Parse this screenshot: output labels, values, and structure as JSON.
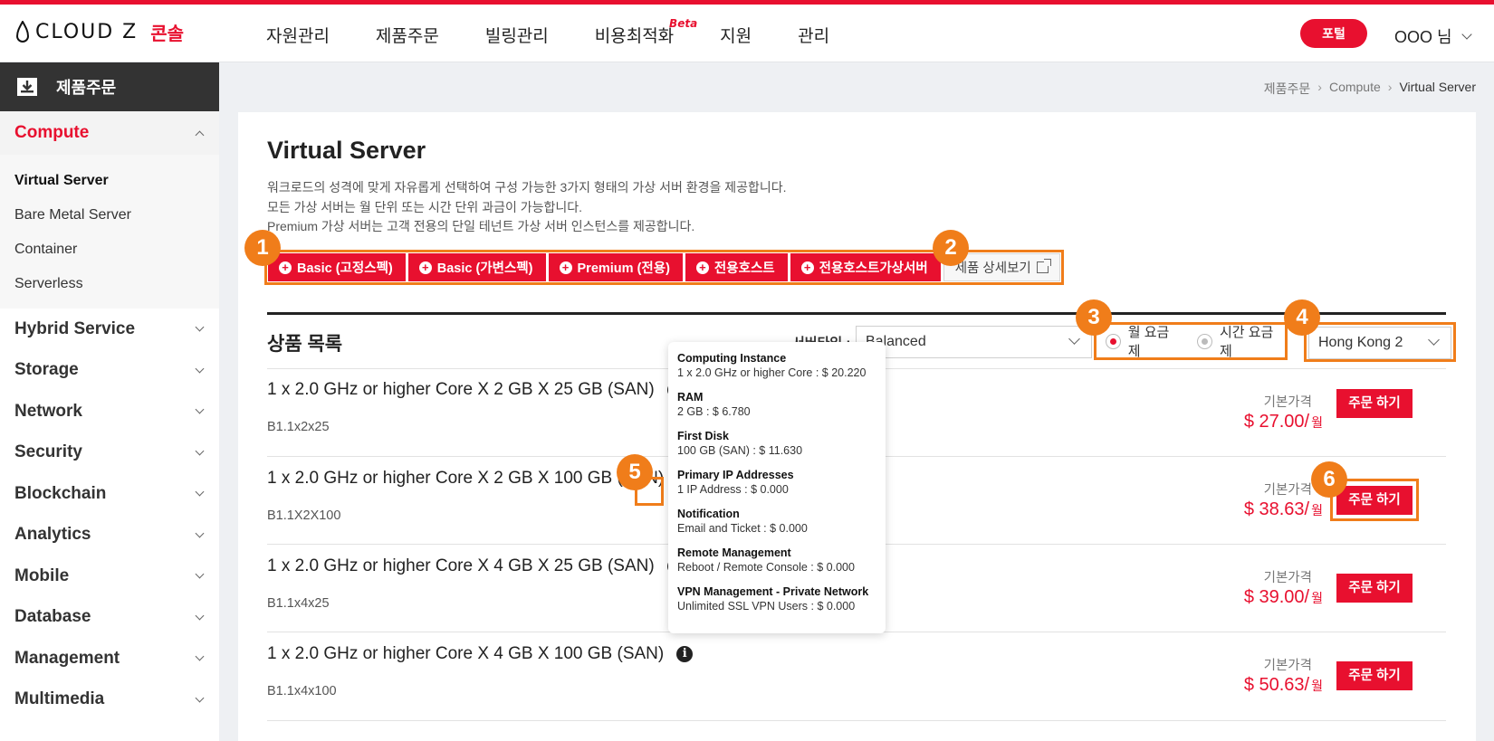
{
  "header": {
    "brand": "CLOUD Z",
    "console": "콘솔",
    "nav": [
      "자원관리",
      "제품주문",
      "빌링관리",
      "비용최적화",
      "지원",
      "관리"
    ],
    "beta": "Beta",
    "portal": "포털",
    "user": "OOO 님"
  },
  "sidebar": {
    "title": "제품주문",
    "active_category": "Compute",
    "sub_items": [
      "Virtual Server",
      "Bare Metal Server",
      "Container",
      "Serverless"
    ],
    "categories": [
      "Hybrid Service",
      "Storage",
      "Network",
      "Security",
      "Blockchain",
      "Analytics",
      "Mobile",
      "Database",
      "Management",
      "Multimedia"
    ]
  },
  "breadcrumb": [
    "제품주문",
    "Compute",
    "Virtual Server"
  ],
  "main": {
    "title": "Virtual Server",
    "desc": [
      "워크로드의 성격에 맞게 자유롭게 선택하여 구성 가능한 3가지 형태의 가상 서버 환경을 제공합니다.",
      "모든 가상 서버는 월 단위 또는 시간 단위 과금이 가능합니다.",
      "Premium 가상 서버는 고객 전용의 단일 테넌트 가상 서버 인스턴스를 제공합니다."
    ],
    "types": [
      "Basic (고정스펙)",
      "Basic (가변스펙)",
      "Premium (전용)",
      "전용호스트",
      "전용호스트가상서버"
    ],
    "detail_button": "제품 상세보기",
    "list_title": "상품 목록",
    "server_type_label": "서버타입 :",
    "server_type_value": "Balanced",
    "billing": [
      "월 요금제",
      "시간 요금제"
    ],
    "region": "Hong Kong 2",
    "base_price_label": "기본가격",
    "order_label": "주문 하기",
    "price_unit": "월",
    "products": [
      {
        "name": "1 x 2.0 GHz or higher Core X 2 GB X 25 GB (SAN)",
        "code": "B1.1x2x25",
        "price": "$ 27.00/"
      },
      {
        "name": "1 x 2.0 GHz or higher Core X 2 GB X 100 GB (SAN)",
        "code": "B1.1X2X100",
        "price": "$ 38.63/"
      },
      {
        "name": "1 x 2.0 GHz or higher Core X 4 GB X 25 GB (SAN)",
        "code": "B1.1x4x25",
        "price": "$ 39.00/"
      },
      {
        "name": "1 x 2.0 GHz or higher Core X 4 GB X 100 GB (SAN)",
        "code": "B1.1x4x100",
        "price": "$ 50.63/"
      }
    ]
  },
  "tooltip": [
    {
      "title": "Computing Instance",
      "value": "1 x 2.0 GHz or higher Core : $ 20.220"
    },
    {
      "title": "RAM",
      "value": "2 GB : $ 6.780"
    },
    {
      "title": "First Disk",
      "value": "100 GB (SAN) : $ 11.630"
    },
    {
      "title": "Primary IP Addresses",
      "value": "1 IP Address : $ 0.000"
    },
    {
      "title": "Notification",
      "value": "Email and Ticket : $ 0.000"
    },
    {
      "title": "Remote Management",
      "value": "Reboot / Remote Console : $ 0.000"
    },
    {
      "title": "VPN Management - Private Network",
      "value": "Unlimited SSL VPN Users : $ 0.000"
    }
  ],
  "annotations": [
    "1",
    "2",
    "3",
    "4",
    "5",
    "6"
  ],
  "colors": {
    "accent": "#e8102f",
    "annotation": "#f07d1a",
    "sidebar_head": "#333333"
  }
}
